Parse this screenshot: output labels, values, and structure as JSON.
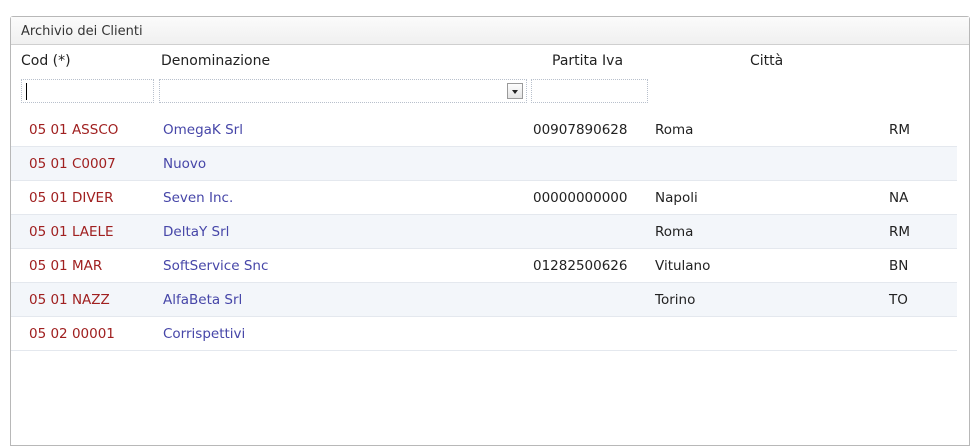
{
  "panel": {
    "title": "Archivio dei Clienti"
  },
  "columns": {
    "cod": "Cod (*)",
    "denominazione": "Denominazione",
    "partita_iva": "Partita Iva",
    "citta": "Città"
  },
  "filters": {
    "cod_value": "",
    "denominazione_value": "",
    "partita_iva_value": ""
  },
  "rows": [
    {
      "cod": "05 01 ASSCO",
      "denominazione": "OmegaK Srl",
      "partita_iva": "00907890628",
      "citta": "Roma",
      "prov": "RM"
    },
    {
      "cod": "05 01 C0007",
      "denominazione": "Nuovo",
      "partita_iva": "",
      "citta": "",
      "prov": ""
    },
    {
      "cod": "05 01 DIVER",
      "denominazione": "Seven Inc.",
      "partita_iva": "00000000000",
      "citta": "Napoli",
      "prov": "NA"
    },
    {
      "cod": "05 01 LAELE",
      "denominazione": "DeltaY Srl",
      "partita_iva": "",
      "citta": "Roma",
      "prov": "RM"
    },
    {
      "cod": "05 01 MAR",
      "denominazione": "SoftService Snc",
      "partita_iva": "01282500626",
      "citta": "Vitulano",
      "prov": "BN"
    },
    {
      "cod": "05 01 NAZZ",
      "denominazione": "AlfaBeta Srl",
      "partita_iva": "",
      "citta": "Torino",
      "prov": "TO"
    },
    {
      "cod": "05 02 00001",
      "denominazione": "Corrispettivi",
      "partita_iva": "",
      "citta": "",
      "prov": ""
    }
  ],
  "colors": {
    "code_text": "#a02020",
    "name_text": "#4646a8",
    "row_alt_bg": "#f3f6fa"
  }
}
